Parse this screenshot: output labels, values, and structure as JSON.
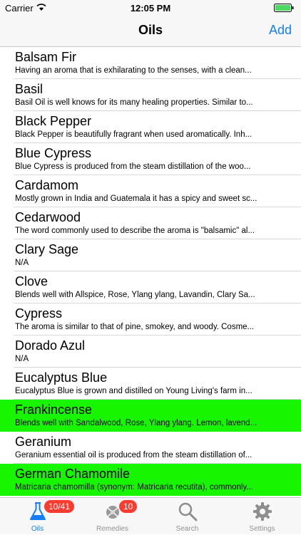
{
  "status_bar": {
    "carrier": "Carrier",
    "time": "12:05 PM"
  },
  "nav": {
    "title": "Oils",
    "add_label": "Add"
  },
  "oils": [
    {
      "name": "Balsam Fir",
      "description": "Having an aroma that is exhilarating to the senses, with a clean..."
    },
    {
      "name": "Basil",
      "description": "Basil Oil is well knows for its many healing properties.  Similar to..."
    },
    {
      "name": "Black Pepper",
      "description": "Black Pepper is beautifully fragrant when used aromatically. Inh..."
    },
    {
      "name": "Blue Cypress",
      "description": "Blue Cypress is produced from the steam distillation of the woo..."
    },
    {
      "name": "Cardamom",
      "description": "Mostly grown in India and Guatemala it has a spicy and sweet sc..."
    },
    {
      "name": "Cedarwood",
      "description": "The word commonly used to describe the aroma is \"balsamic\" al..."
    },
    {
      "name": "Clary Sage",
      "description": "N/A"
    },
    {
      "name": "Clove",
      "description": "Blends well with Allspice, Rose, Ylang ylang, Lavandin, Clary Sa..."
    },
    {
      "name": "Cypress",
      "description": "The aroma is similar to that of pine, smokey, and woody.  Cosme..."
    },
    {
      "name": "Dorado Azul",
      "description": "N/A"
    },
    {
      "name": "Eucalyptus Blue",
      "description": "Eucalyptus Blue is grown and distilled on Young Living's farm in..."
    },
    {
      "name": "Frankincense",
      "description": "Blends well with Sandalwood, Rose, Ylang ylang. Lemon, lavend...",
      "highlighted": true
    },
    {
      "name": "Geranium",
      "description": "Geranium essential oil is produced from the steam distillation of..."
    },
    {
      "name": "German Chamomile",
      "description": "Matricaria chamomilla (synonym: Matricaria recutita), commonly...",
      "highlighted": true
    }
  ],
  "tabs": {
    "oils": {
      "label": "Oils",
      "badge": "10/41"
    },
    "remedies": {
      "label": "Remedies",
      "badge": "10"
    },
    "search": {
      "label": "Search"
    },
    "settings": {
      "label": "Settings"
    }
  },
  "colors": {
    "accent": "#157efb",
    "highlight": "#18f500",
    "badge": "#ff3b30"
  }
}
